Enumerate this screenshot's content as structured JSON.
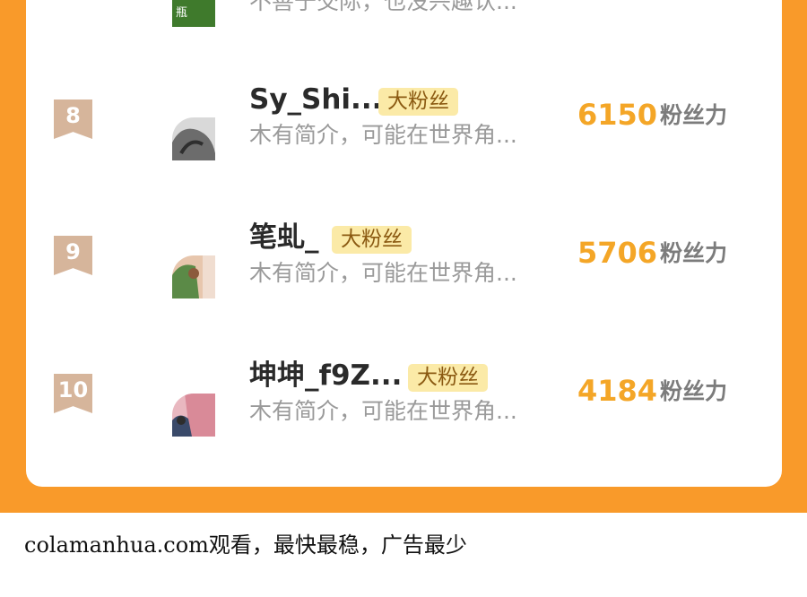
{
  "top_partial": {
    "description": "不善于交际，也没兴趣认...",
    "avatar_text": "瓶"
  },
  "rows": [
    {
      "rank": "8",
      "name": "Sy_Shi...",
      "badge": "大粉丝",
      "description": "木有简介，可能在世界角...",
      "score": "6150",
      "score_unit": "粉丝力"
    },
    {
      "rank": "9",
      "name": "笔虬_",
      "badge": "大粉丝",
      "description": "木有简介，可能在世界角...",
      "score": "5706",
      "score_unit": "粉丝力"
    },
    {
      "rank": "10",
      "name": "坤坤_f9Z...",
      "badge": "大粉丝",
      "description": "木有简介，可能在世界角...",
      "score": "4184",
      "score_unit": "粉丝力"
    }
  ],
  "footer": {
    "text": "colamanhua.com观看，最快最稳，广告最少"
  },
  "colors": {
    "frame_orange": "#f99a2a",
    "score_orange": "#f4a627",
    "badge_bg": "#fbeaa7",
    "rank_badge": "#d6b59b"
  }
}
